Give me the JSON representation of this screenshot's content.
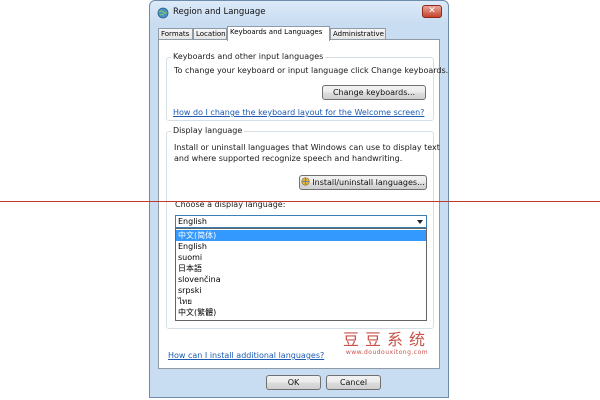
{
  "window": {
    "title": "Region and Language",
    "close_glyph": "✕"
  },
  "tabs": [
    {
      "label": "Formats"
    },
    {
      "label": "Location"
    },
    {
      "label": "Keyboards and Languages"
    },
    {
      "label": "Administrative"
    }
  ],
  "active_tab": "Keyboards and Languages",
  "keyboards": {
    "group_label": "Keyboards and other input languages",
    "description": "To change your keyboard or input language click Change keyboards.",
    "change_button": "Change keyboards...",
    "welcome_link": "How do I change the keyboard layout for the Welcome screen?"
  },
  "display_language": {
    "group_label": "Display language",
    "description_line1": "Install or uninstall languages that Windows can use to display text",
    "description_line2": "and where supported recognize speech and handwriting.",
    "install_button": "Install/uninstall languages...",
    "choose_label": "Choose a display language:",
    "selected_value": "English",
    "options": [
      {
        "label": "中文(简体)",
        "highlighted": true
      },
      {
        "label": "English",
        "highlighted": false
      },
      {
        "label": "suomi",
        "highlighted": false
      },
      {
        "label": "日本語",
        "highlighted": false
      },
      {
        "label": "slovenčina",
        "highlighted": false
      },
      {
        "label": "srpski",
        "highlighted": false
      },
      {
        "label": "ไทย",
        "highlighted": false
      },
      {
        "label": "中文(繁體)",
        "highlighted": false
      }
    ]
  },
  "footer": {
    "install_link": "How can I install additional languages?",
    "ok_button": "OK",
    "cancel_button": "Cancel"
  },
  "watermark": {
    "text": "豆豆系统",
    "url": "www.doudouxitong.com"
  },
  "colors": {
    "highlight": "#3399ff",
    "link": "#1d5bb3",
    "close_button": "#c7432d",
    "annotation_line": "#c0392b"
  }
}
